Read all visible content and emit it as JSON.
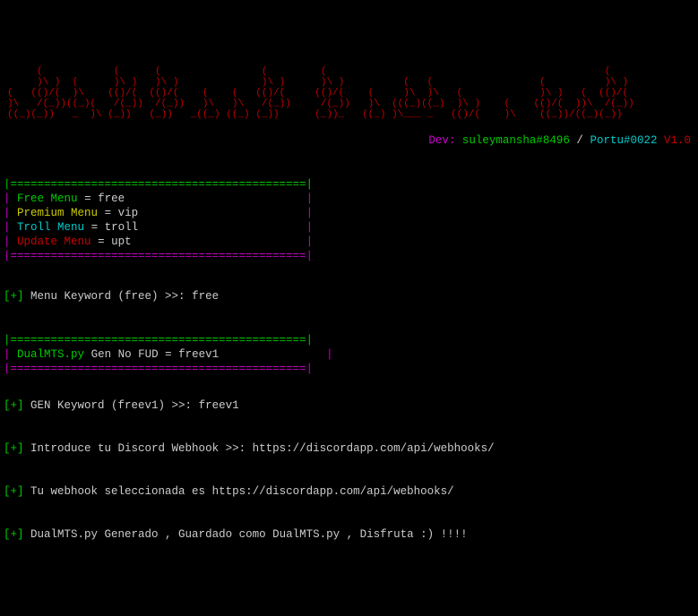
{
  "ascii": "     (            (      (                 (         (                                               (    \n     )\\ )  (      )\\ )   )\\ )              )\\ )      )\\ )          (   (                  (          )\\ ) \n(   (()/(  )\\    (()/(  (()/(    (    (   (()/(     (()/(    (     )\\  )\\   (             )\\ )   (  (()/( \n)\\   /(_))((_)(   /(_))  /(_))   )\\   )\\   /(_))     /(_))   )\\  (((_)((_)  )\\ )    (    (()/(  ))\\  /(_))\n((_)(_))   _  )\\ (_))   (_))   _((_) ((_) (_))      (_))_   ((_) )\\___ _   (()/(    )\\    ((_))/((_)(_))  ",
  "dev": {
    "label": "Dev:",
    "user1": "suleymansha#8496",
    "sep": "/",
    "user2": "Portu#0022",
    "version": "V1.0"
  },
  "menu": {
    "divider": "|============================================|",
    "items": [
      {
        "label": "Free Menu",
        "eq": "=",
        "value": "free",
        "color": "green"
      },
      {
        "label": "Premium Menu",
        "eq": "=",
        "value": "vip",
        "color": "yellow"
      },
      {
        "label": "Troll Menu",
        "eq": "=",
        "value": "troll",
        "color": "cyan"
      },
      {
        "label": "Update Menu",
        "eq": "=",
        "value": "upt",
        "color": "red"
      }
    ]
  },
  "prompt1": {
    "marker": "[+]",
    "text": "Menu Keyword (free) >>:",
    "input": "free"
  },
  "gen_menu": {
    "divider": "|============================================|",
    "label": "DualMTS.py",
    "text": "Gen No FUD =",
    "value": "freev1"
  },
  "prompt2": {
    "marker": "[+]",
    "text": "GEN Keyword (freev1) >>:",
    "input": "freev1"
  },
  "webhook_prompt": {
    "marker": "[+]",
    "text": "Introduce tu Discord Webhook >>:",
    "value": "https://discordapp.com/api/webhooks/"
  },
  "webhook_confirm": {
    "marker": "[+]",
    "text": "Tu webhook seleccionada es",
    "value": "https://discordapp.com/api/webhooks/"
  },
  "generated": {
    "marker": "[+]",
    "text": "DualMTS.py Generado , Guardado como DualMTS.py , Disfruta :) !!!!"
  }
}
